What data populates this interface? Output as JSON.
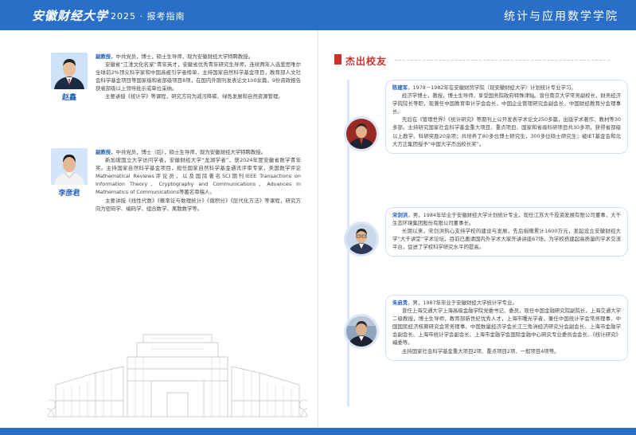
{
  "header": {
    "logo_text": "安徽财经大学",
    "separator": "|",
    "guide_title": "2025 · 报考指南",
    "college_name": "统计与应用数学学院"
  },
  "left_page": {
    "faculty": [
      {
        "name": "赵鑫",
        "title": "副教授",
        "bio": [
          "，中共党员，博士，硕士生导师，现为安徽财经大学特聘教授。",
          "安徽省“江淮文化名家”青年英才，安徽省优秀青年研究生导师，连续两年入选爱思唯尔全球前2%顶尖科学家和中国高被引学者榜单，主持国家自然科学基金项目，教育部人文社会科学基金项目等国家级和省部级项目8项，在国内外期刊发表论文100余篇，9份资政报告获省部级以上领导批示或单位采纳。",
          "主要讲授《统计学》等课程，研究方向为减污降碳、绿色发展和自然资源管理。"
        ]
      },
      {
        "name": "李彦君",
        "title": "副教授",
        "bio": [
          "，中共党员，博士（后），硕士生导师，现为安徽财经大学特聘教授。",
          "新加坡国立大学访问学者，安徽财经大学“龙湖学者”，获2024年度安徽省数学青年奖。主持国家自然科学基金项目，担任国家自然科学基金通讯评审专家，美国数学评论Mathematical Reviews评论员，以及国际著名SCI期刊IEEE Transactions on Information Theory、Cryptography and Communications、Advances in Mathematics of Communications等匿名审稿人。",
          "主要讲授《线性代数》《概率论与数理统计》《微积分》《层代化方法》等课程，研究方向为密码学、编码学、组合数学、离散数学等。"
        ]
      }
    ]
  },
  "right_page": {
    "section_title": "杰出校友",
    "alumni": [
      {
        "name": "陈建军",
        "bio": [
          "，1978－1982年在安徽财贸学院（现安徽财经大学）计划统计专业学习。",
          "经济学博士，教授，博士生导师，享受国务院政府特殊津贴。曾任南京大学常务副校长，财务经济学院院长等职，现兼任中国教育审计学会会长、中国企业管理研究会副会长、中国财经教育分会理事长。",
          "先后在《管理世界》《统计研究》等期刊上公开发表学术论文250多篇，出版学术著作、教材等30多部。主持研究国家社会科学基金重大项目、重点项目、国家和省级科研项目共30多项，获得省部级以上教学、科研奖励20余项；共培养了80多位博士研究生，300多位硕士研究生；被IET基金会和北大方正集团授予“中国大学杰出校长奖”。"
        ]
      },
      {
        "name": "宋剑洪",
        "bio": [
          "，男，1984年毕业于安徽财经大学计划统计专业，现任江苏大千投资发展有限公司董事，大千生态环境集团股份有限公司董事长。",
          "长期以来，宋剑洪热心支持学校的建设与发展，先后捐赠累计1600万元，发起设立安徽财经大学“大千讲堂”学术论坛，目前已邀请国内外学术大家开讲讲座67场，为学校搭建起高质量的学术交流平台，促进了学校科学研究水平的提高。"
        ]
      },
      {
        "name": "朱启贵",
        "bio": [
          "，男，1987年毕业于安徽财经大学统计学专业。",
          "曾任上海交通大学上海高级金融学院党委书记、委员，现任中国金融研究院副院长，上海交通大学二级教授，博士生导师，教育部新世纪优秀人才，上海市曙光学者，兼任中国统计学会常务理事、中国国民经济核算研究会常务理事、中国数量经济学会长江三角洲经济研究分会副会长、上海市金融学会副会长、上海市统计学会副会长、上海市金融学会国际金融中心研究专业委员会会长、《统计研究》编委等。",
          "主持国家社会科学基金重大项目2项、重点项目2项、一般项目4项等。"
        ]
      }
    ]
  },
  "colors": {
    "brand_blue": "#2a6fc7",
    "accent_red": "#c9322b",
    "name_blue": "#1f5fbf"
  }
}
